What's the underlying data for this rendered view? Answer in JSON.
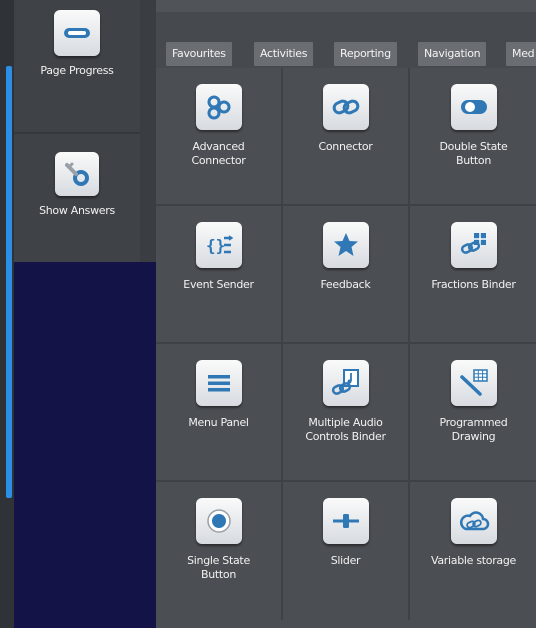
{
  "sidebar": {
    "items": [
      {
        "label": "Page Progress",
        "icon": "page-progress-icon"
      },
      {
        "label": "Show Answers",
        "icon": "key-icon"
      }
    ]
  },
  "tabs": [
    {
      "label": "Favourites"
    },
    {
      "label": "Activities"
    },
    {
      "label": "Reporting"
    },
    {
      "label": "Navigation"
    },
    {
      "label": "Med"
    }
  ],
  "addons": [
    {
      "label": "Advanced\nConnector",
      "icon": "advanced-connector-icon"
    },
    {
      "label": "Connector",
      "icon": "connector-icon"
    },
    {
      "label": "Double State\nButton",
      "icon": "double-state-button-icon"
    },
    {
      "label": "Event Sender",
      "icon": "event-sender-icon"
    },
    {
      "label": "Feedback",
      "icon": "star-icon"
    },
    {
      "label": "Fractions Binder",
      "icon": "fractions-binder-icon"
    },
    {
      "label": "Menu Panel",
      "icon": "menu-icon"
    },
    {
      "label": "Multiple Audio\nControls Binder",
      "icon": "audio-binder-icon"
    },
    {
      "label": "Programmed\nDrawing",
      "icon": "drawing-icon"
    },
    {
      "label": "Single State\nButton",
      "icon": "single-state-button-icon"
    },
    {
      "label": "Slider",
      "icon": "slider-icon"
    },
    {
      "label": "Variable storage",
      "icon": "cloud-storage-icon"
    }
  ],
  "colors": {
    "accent": "#2b8fe6",
    "icon_blue": "#2f78b5",
    "dark_area": "#141347"
  }
}
